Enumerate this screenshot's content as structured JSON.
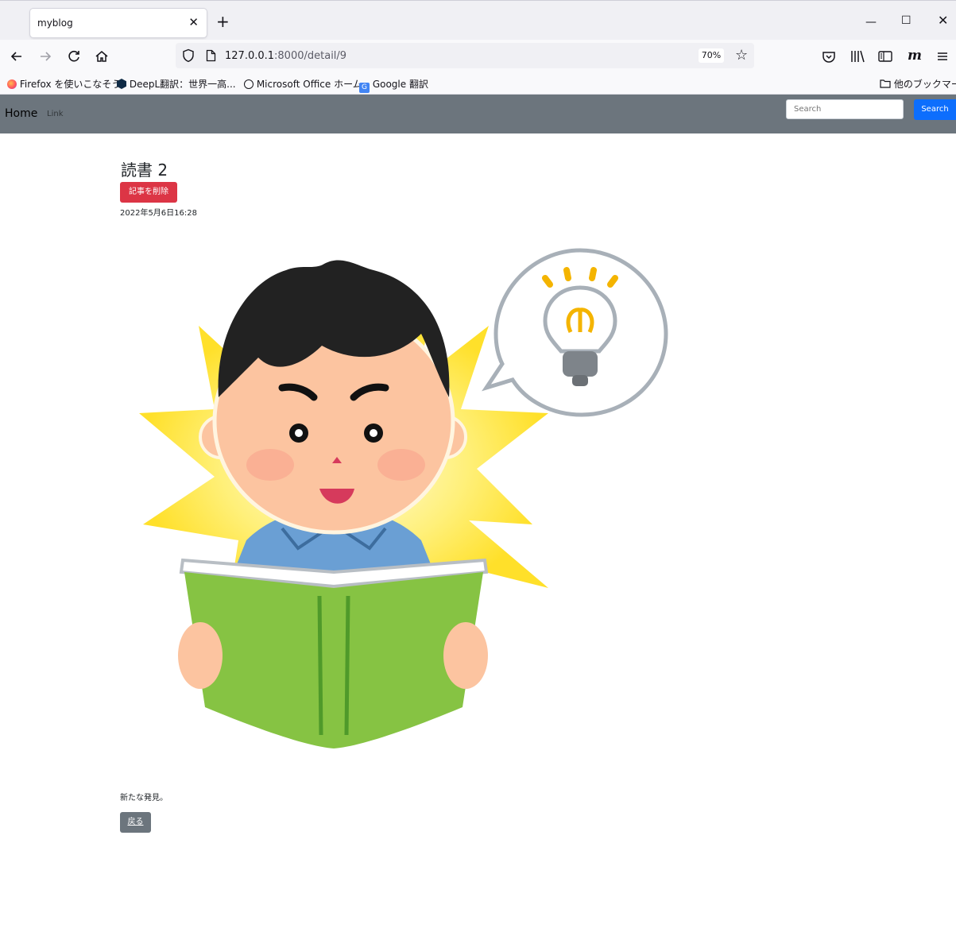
{
  "browser": {
    "tab_title": "myblog",
    "url_host": "127.0.0.1",
    "url_path": ":8000/detail/9",
    "zoom": "70%",
    "bookmarks": [
      "Firefox を使いこなそう",
      "DeepL翻訳：世界一高...",
      "Microsoft Office ホーム",
      "Google 翻訳"
    ],
    "other_bookmarks": "他のブックマーク"
  },
  "site_nav": {
    "brand": "Home",
    "link": "Link",
    "search_placeholder": "Search",
    "search_button": "Search"
  },
  "article": {
    "title": "読書 2",
    "delete_button": "記事を削除",
    "date": "2022年5月6日16:28",
    "body": "新たな発見。",
    "back_button": "戻る"
  },
  "colors": {
    "navbar_bg": "#6c757d",
    "danger": "#dc3545",
    "primary": "#0d6efd",
    "secondary": "#6c757d"
  }
}
